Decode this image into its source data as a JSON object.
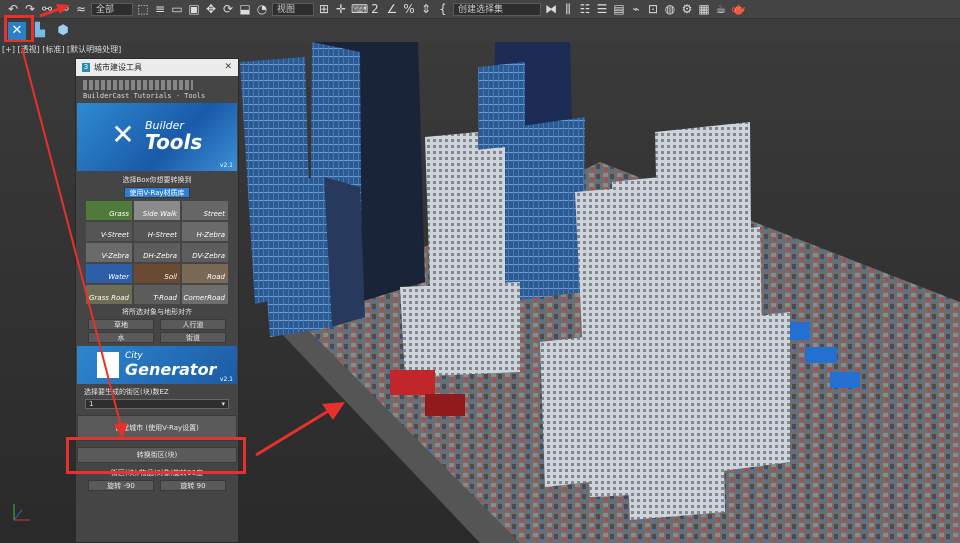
{
  "toolbar": {
    "selection_filter": "全部",
    "view_dropdown": "视图",
    "named_selection_placeholder": "创建选择集"
  },
  "viewport": {
    "label": "[+] [透视] [标准] [默认明暗处理]"
  },
  "panel": {
    "title": "城市建设工具",
    "subtitle": "BuilderCast Tutorials - Tools",
    "banner": {
      "line1": "Builder",
      "line2": "Tools",
      "version": "v2.1"
    },
    "prompt_select": "选择Box你想要转换到",
    "vray_button": "使用V-Ray材质库",
    "tiles": [
      {
        "label": "Grass",
        "color": "#4f7a3a"
      },
      {
        "label": "Side Walk",
        "color": "#8a8a8a"
      },
      {
        "label": "Street",
        "color": "#666"
      },
      {
        "label": "V-Street",
        "color": "#555"
      },
      {
        "label": "H-Street",
        "color": "#555"
      },
      {
        "label": "H-Zebra",
        "color": "#6a6a6a"
      },
      {
        "label": "V-Zebra",
        "color": "#6a6a6a"
      },
      {
        "label": "DH-Zebra",
        "color": "#5d5d5d"
      },
      {
        "label": "DV-Zebra",
        "color": "#5d5d5d"
      },
      {
        "label": "Water",
        "color": "#2d5fa8"
      },
      {
        "label": "Soil",
        "color": "#6b4a33"
      },
      {
        "label": "Road",
        "color": "#7a6a55"
      },
      {
        "label": "Grass Road",
        "color": "#6d6d55"
      },
      {
        "label": "T-Road",
        "color": "#5c5c5c"
      },
      {
        "label": "CornerRoad",
        "color": "#6e6e6e"
      }
    ],
    "align_label": "将所选对象与地形对齐",
    "align_buttons": [
      "草地",
      "人行道",
      "水",
      "街道"
    ],
    "generator": {
      "line1": "City",
      "line2": "Generator",
      "version": "v2.1"
    },
    "block_count_label": "选择要生成的街区(块)数EZ",
    "block_count_value": "1",
    "create_city_button": "创建城市 (使用V-Ray设置)",
    "convert_block_button": "转换街区(块)",
    "rotate_label": "街区(块)/物品(对象)旋转90度",
    "rotate_buttons": [
      "旋转 -90",
      "旋转 90"
    ]
  }
}
